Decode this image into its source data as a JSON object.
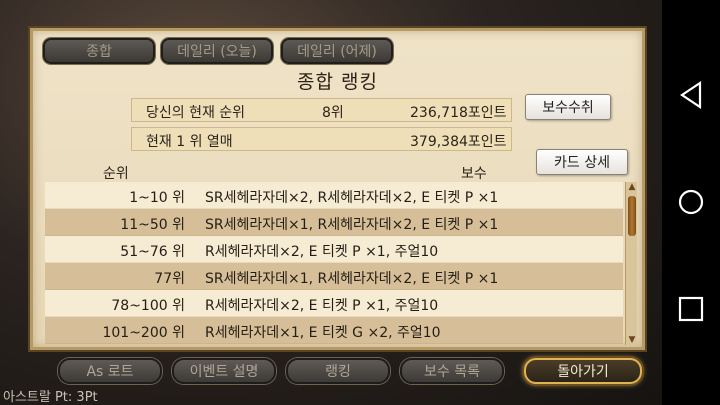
{
  "tabs": [
    "종합",
    "데일리 (오늘)",
    "데일리 (어제)"
  ],
  "title": "종합 랭킹",
  "my_rank": {
    "label": "당신의 현재 순위",
    "rank": "8위",
    "points": "236,718포인트"
  },
  "top_rank": {
    "label": "현재 1 위  열매",
    "points": "379,384포인트"
  },
  "buttons": {
    "claim": "보수수취",
    "card_detail": "카드 상세"
  },
  "columns": {
    "rank": "순위",
    "reward": "보수"
  },
  "rows": [
    {
      "rank": "1~10 위",
      "reward": "SR세헤라자데×2, R세헤라자데×2, E 티켓 P ×1"
    },
    {
      "rank": "11~50 위",
      "reward": "SR세헤라자데×1, R세헤라자데×2, E 티켓 P ×1"
    },
    {
      "rank": "51~76 위",
      "reward": "R세헤라자데×2, E 티켓 P ×1, 주얼10"
    },
    {
      "rank": "77위",
      "reward": "SR세헤라자데×1, R세헤라자데×2, E 티켓 P ×1"
    },
    {
      "rank": "78~100 위",
      "reward": "R세헤라자데×2, E 티켓 P ×1, 주얼10"
    },
    {
      "rank": "101~200 위",
      "reward": "R세헤라자데×1, E 티켓 G ×2, 주얼10"
    }
  ],
  "bottom_nav": [
    "As 로트",
    "이벤트 설명",
    "랭킹",
    "보수 목록",
    "돌아가기"
  ],
  "astral_points": "아스트랄 Pt: 3Pt",
  "system_nav": {
    "back": "back-icon",
    "home": "home-icon",
    "recent": "recent-apps-icon"
  }
}
